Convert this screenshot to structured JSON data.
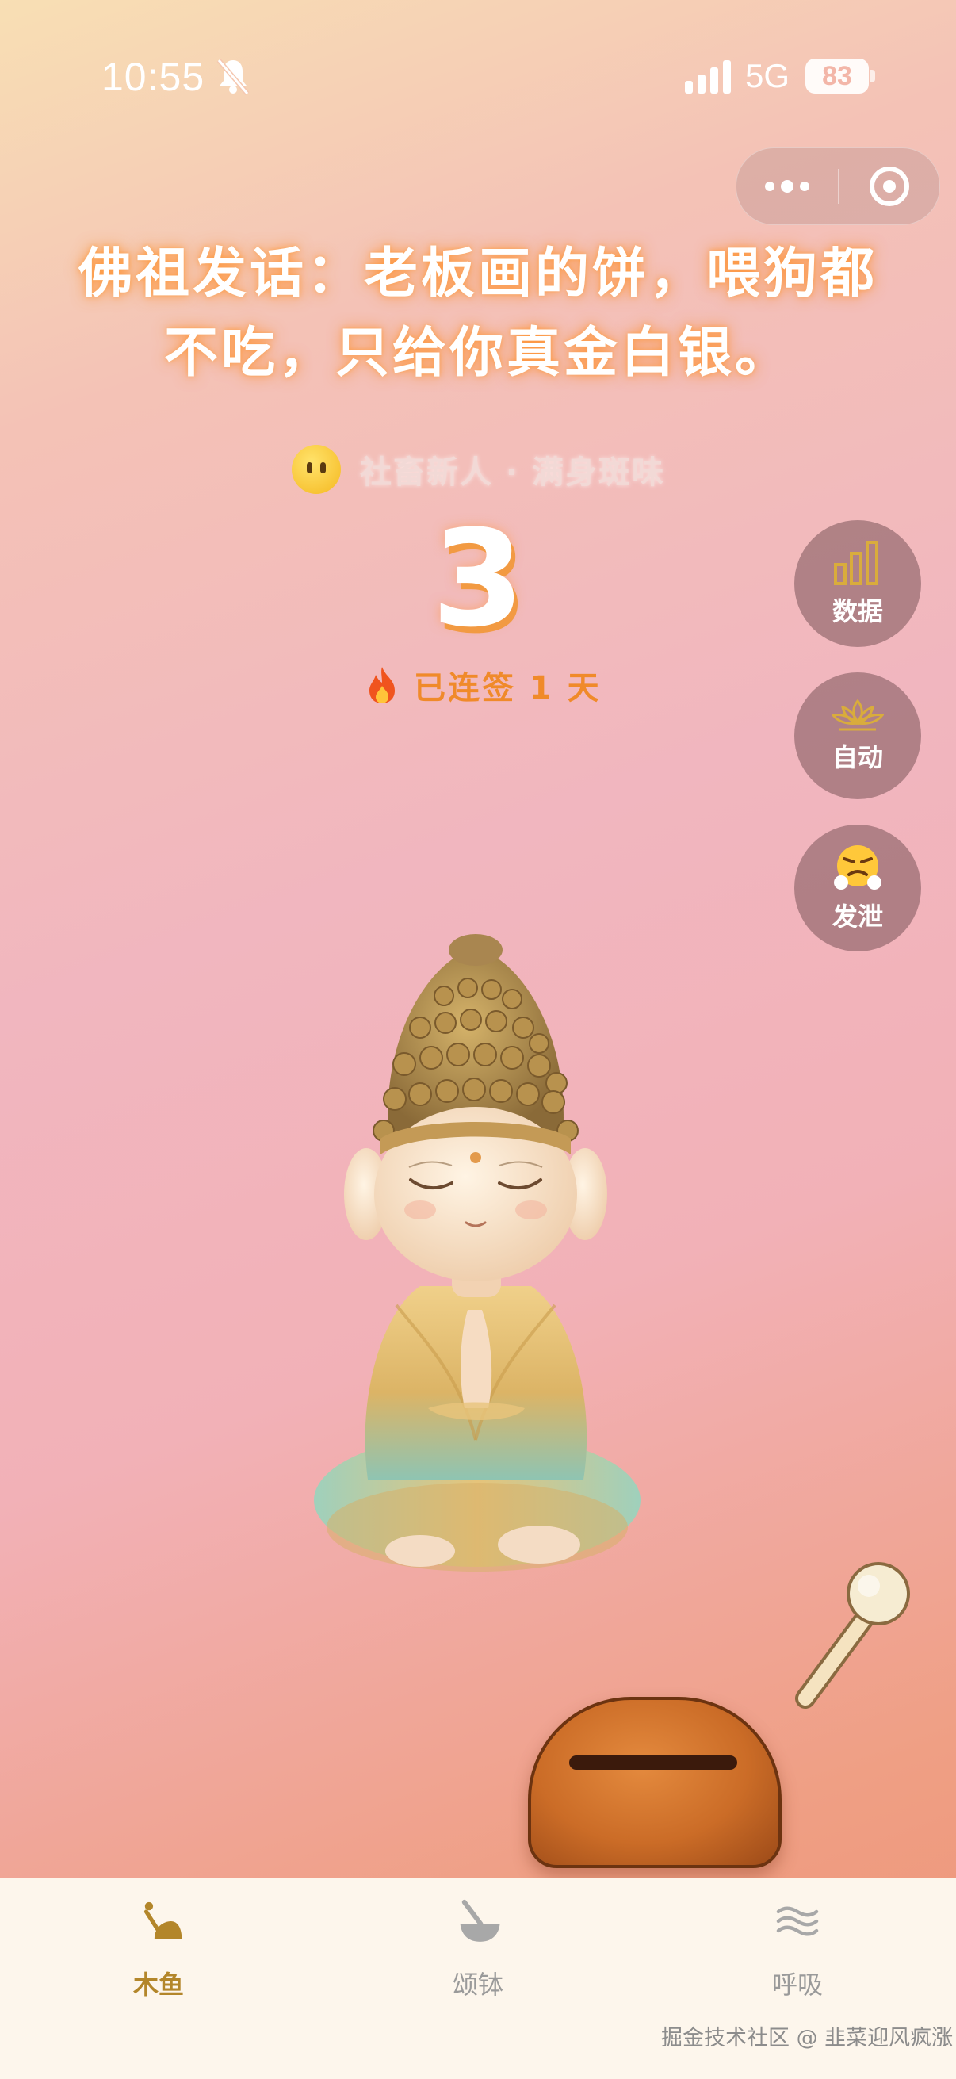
{
  "status_bar": {
    "time": "10:55",
    "network": "5G",
    "battery": "83",
    "icons": [
      "bell-mute-icon",
      "signal-icon"
    ]
  },
  "capsule": {
    "icons": [
      "more-dots-icon",
      "close-target-icon"
    ]
  },
  "quote": {
    "line1": "佛祖发话：老板画的饼，喂狗都",
    "line2": "不吃，只给你真金白银。"
  },
  "rank": {
    "text": "社畜新人 · 满身斑味",
    "icon": "neutral-face-icon"
  },
  "counter": {
    "value": "3"
  },
  "streak": {
    "text": "已连签 1 天",
    "icon": "flame-icon"
  },
  "side_buttons": [
    {
      "label": "数据",
      "icon": "bar-chart-icon"
    },
    {
      "label": "自动",
      "icon": "lotus-icon"
    },
    {
      "label": "发泄",
      "icon": "angry-face-icon"
    }
  ],
  "tabs": [
    {
      "label": "木鱼",
      "icon": "wooden-fish-icon",
      "active": true
    },
    {
      "label": "颂钵",
      "icon": "singing-bowl-icon",
      "active": false
    },
    {
      "label": "呼吸",
      "icon": "waves-icon",
      "active": false
    }
  ],
  "watermark": "掘金技术社区 @ 韭菜迎风疯涨",
  "colors": {
    "accent": "#f08a2a",
    "tab_active": "#b3862a",
    "tab_inactive": "#9a9a9a"
  }
}
